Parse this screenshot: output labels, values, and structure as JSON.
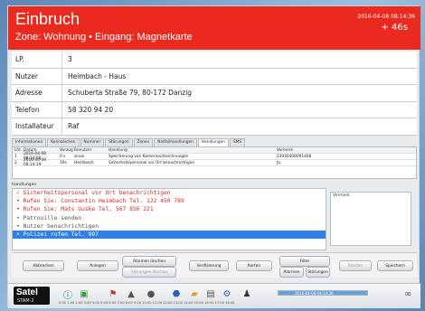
{
  "header": {
    "title": "Einbruch",
    "subtitle": "Zone: Wohnung • Eingang: Magnetkarte",
    "timestamp": "2016-04-08 08:14:36",
    "elapsed": "+ 46s",
    "color": "#ea2a1f"
  },
  "info": {
    "rows": [
      {
        "label": "LP.",
        "value": "3"
      },
      {
        "label": "Nutzer",
        "value": "Heimbach - Haus"
      },
      {
        "label": "Adresse",
        "value": "Schuberta Straße 79, 80-172 Danzig"
      },
      {
        "label": "Telefon",
        "value": "58 320 94 20"
      },
      {
        "label": "Installateur",
        "value": "Raf"
      }
    ]
  },
  "tabs": [
    "Informationen",
    "Kennzeichen",
    "Nummer",
    "Störungen",
    "Zonen",
    "Notfallhandlungen",
    "Handlungen",
    "SMS"
  ],
  "table": {
    "headers": [
      "Lfd.",
      "Datum",
      "Verzug",
      "Benutzer",
      "Handlung",
      "Vermerk"
    ],
    "rows": [
      [
        "1",
        "2016-04-08 08:14:08",
        "0 s",
        "sinan",
        "Speicherung von Kameraaufzeichnungen",
        "23040408091408"
      ],
      [
        "2",
        "2016-04-08 08:14:19",
        "19s",
        "Heimbach",
        "Sicherheitspersonal vor Ort benachrichtigen",
        "Ja"
      ]
    ]
  },
  "procedures": {
    "label": "Handlungen",
    "items": [
      "✓ Sicherheitspersonal vor Ort benachrichtigen",
      "• Rufen Sie: Constantin Heimbach Tel. 122 450 789",
      "• Rufen Sie: Mats Guske Tel. 567 856 221",
      "• Patrouille senden",
      "• Nutzer benachrichtigen",
      "• Polizei rufen Tel. 997"
    ]
  },
  "note": {
    "label": "Vermerk"
  },
  "buttons": {
    "abbrechen": "Abbrechen",
    "anlegen": "Anlegen",
    "alarmen_loschen": "Alarmen löschen",
    "storungen_loschen": "Störungen löschen",
    "verifizierung": "Verifizierung",
    "karte": "Karten",
    "filter": "Filter",
    "alarmen": "Alarmen",
    "storungen": "Störungen",
    "senden": "Senden",
    "speichern": "Speichern"
  },
  "taskbar": {
    "brand": "Satel",
    "product": "STAM-2",
    "progress_text": "2016-04-08 08:14:36",
    "strip": "0:00 1:00 2:00 3:00 4:00 5:00 6:00 7:00 8:00 9:00 10:00 11:00 12:00 13:00 14:00 15:00 16:00 17:00 18:00"
  }
}
